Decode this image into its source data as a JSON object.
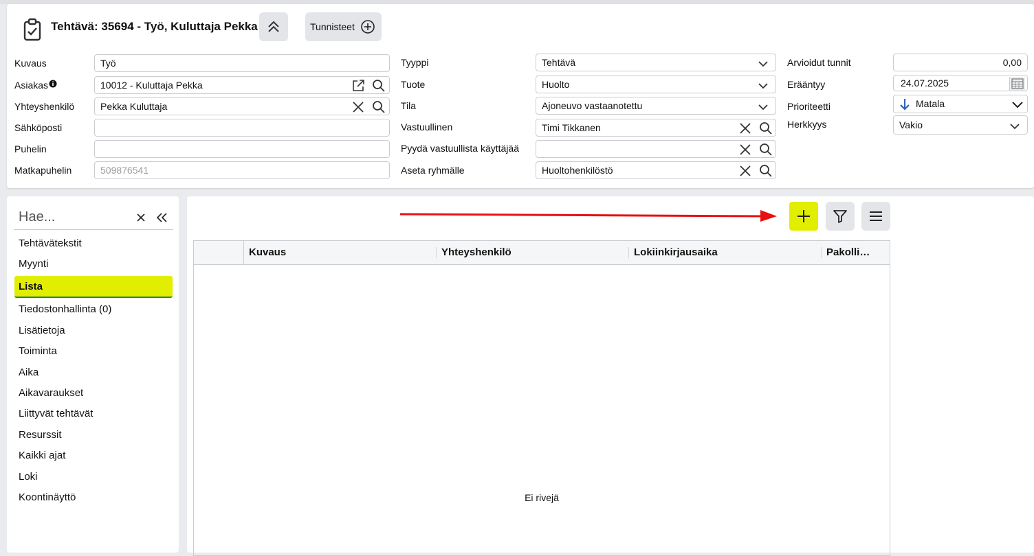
{
  "header": {
    "title": "Tehtävä: 35694 - Työ, Kuluttaja Pekka",
    "tags_label": "Tunnisteet"
  },
  "form": {
    "left": [
      {
        "label": "Kuvaus",
        "value": "Työ"
      },
      {
        "label": "Asiakas",
        "value": "10012 - Kuluttaja Pekka"
      },
      {
        "label": "Yhteyshenkilö",
        "value": "Pekka Kuluttaja"
      },
      {
        "label": "Sähköposti",
        "value": ""
      },
      {
        "label": "Puhelin",
        "value": ""
      },
      {
        "label": "Matkapuhelin",
        "placeholder": "509876541"
      }
    ],
    "middle": [
      {
        "label": "Tyyppi",
        "value": "Tehtävä"
      },
      {
        "label": "Tuote",
        "value": "Huolto"
      },
      {
        "label": "Tila",
        "value": "Ajoneuvo vastaanotettu"
      },
      {
        "label": "Vastuullinen",
        "value": "Timi Tikkanen"
      },
      {
        "label": "Pyydä vastuullista käyttäjää",
        "value": ""
      },
      {
        "label": "Aseta ryhmälle",
        "value": "Huoltohenkilöstö"
      }
    ],
    "right": [
      {
        "label": "Arvioidut tunnit",
        "value": "0,00"
      },
      {
        "label": "Erääntyy",
        "value": "24.07.2025"
      },
      {
        "label": "Prioriteetti",
        "value": "Matala"
      },
      {
        "label": "Herkkyys",
        "value": "Vakio"
      }
    ]
  },
  "sidebar": {
    "search_placeholder": "Hae...",
    "items": [
      {
        "label": "Tehtävätekstit"
      },
      {
        "label": "Myynti"
      },
      {
        "label": "Lista"
      },
      {
        "label": "Tiedostonhallinta (0)"
      },
      {
        "label": "Lisätietoja"
      },
      {
        "label": "Toiminta"
      },
      {
        "label": "Aika"
      },
      {
        "label": "Aikavaraukset"
      },
      {
        "label": "Liittyvät tehtävät"
      },
      {
        "label": "Resurssit"
      },
      {
        "label": "Kaikki ajat"
      },
      {
        "label": "Loki"
      },
      {
        "label": "Koontinäyttö"
      }
    ],
    "active_item": "Lista"
  },
  "grid": {
    "columns": [
      "Kuvaus",
      "Yhteyshenkilö",
      "Lokiinkirjausaika",
      "Pakolli…"
    ],
    "empty_text": "Ei rivejä"
  },
  "colors": {
    "highlight": "#e2ee00",
    "arrow": "#e81010",
    "priority_icon": "#2b63b8"
  }
}
